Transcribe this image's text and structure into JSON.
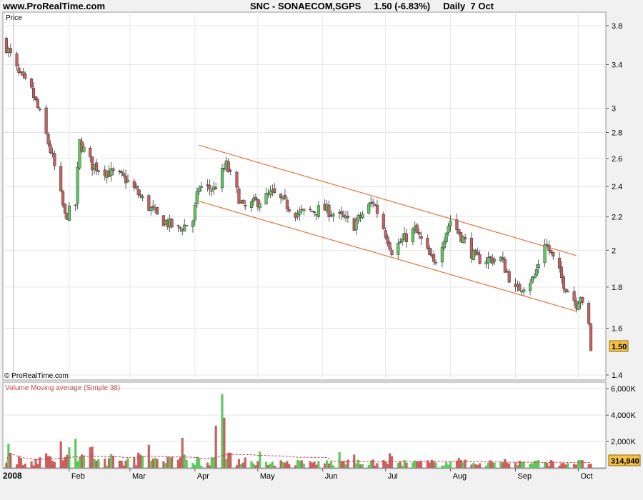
{
  "header": {
    "site": "www.ProRealTime.com",
    "symbol": "SNC - SONAECOM,SGPS",
    "quote": "1.50 (-6.83%)",
    "period": "Daily",
    "date": "7 Oct"
  },
  "price_panel": {
    "axis_label": "Price",
    "copyright": "© ProRealTime.com",
    "last_price_badge": "1.50",
    "y_ticks": [
      "3.8",
      "3.4",
      "3",
      "2.8",
      "2.6",
      "2.4",
      "2.2",
      "2",
      "1.8",
      "1.6",
      "1.4"
    ]
  },
  "volume_panel": {
    "label": "Volume Moving average (Simple 38)",
    "y_ticks": [
      "6,000K",
      "4,000K",
      "2,000K"
    ],
    "last_volume_badge": "314,940"
  },
  "x_axis": {
    "year_label": "2008",
    "months": [
      "Feb",
      "Mar",
      "Apr",
      "May",
      "Jun",
      "Jul",
      "Aug",
      "Sep",
      "Oct"
    ]
  },
  "colors": {
    "up": "#5dc85d",
    "down": "#c86060",
    "channel": "#e8733a",
    "volume_ma": "#d04040",
    "badge_price": "#f5c242"
  },
  "chart_data": {
    "type": "candlestick",
    "title": "SNC - SONAECOM,SGPS",
    "period": "Daily",
    "y_scale": "log",
    "ylim": [
      1.38,
      3.95
    ],
    "last_close": 1.5,
    "change_pct": -6.83,
    "close_anchors": [
      {
        "date": "2008-01-02",
        "close": 3.58
      },
      {
        "date": "2008-01-08",
        "close": 3.3
      },
      {
        "date": "2008-01-14",
        "close": 3.15
      },
      {
        "date": "2008-01-18",
        "close": 2.95
      },
      {
        "date": "2008-01-24",
        "close": 2.6
      },
      {
        "date": "2008-01-30",
        "close": 2.2
      },
      {
        "date": "2008-02-04",
        "close": 2.28
      },
      {
        "date": "2008-02-06",
        "close": 2.72
      },
      {
        "date": "2008-02-12",
        "close": 2.55
      },
      {
        "date": "2008-02-20",
        "close": 2.5
      },
      {
        "date": "2008-02-28",
        "close": 2.45
      },
      {
        "date": "2008-03-06",
        "close": 2.33
      },
      {
        "date": "2008-03-14",
        "close": 2.2
      },
      {
        "date": "2008-03-24",
        "close": 2.12
      },
      {
        "date": "2008-03-31",
        "close": 2.18
      },
      {
        "date": "2008-04-03",
        "close": 2.4
      },
      {
        "date": "2008-04-10",
        "close": 2.38
      },
      {
        "date": "2008-04-16",
        "close": 2.55
      },
      {
        "date": "2008-04-24",
        "close": 2.25
      },
      {
        "date": "2008-05-08",
        "close": 2.35
      },
      {
        "date": "2008-05-20",
        "close": 2.22
      },
      {
        "date": "2008-06-02",
        "close": 2.25
      },
      {
        "date": "2008-06-16",
        "close": 2.15
      },
      {
        "date": "2008-06-25",
        "close": 2.3
      },
      {
        "date": "2008-07-04",
        "close": 2.0
      },
      {
        "date": "2008-07-15",
        "close": 2.12
      },
      {
        "date": "2008-07-24",
        "close": 1.92
      },
      {
        "date": "2008-08-01",
        "close": 2.18
      },
      {
        "date": "2008-08-13",
        "close": 1.95
      },
      {
        "date": "2008-08-25",
        "close": 1.95
      },
      {
        "date": "2008-09-01",
        "close": 1.78
      },
      {
        "date": "2008-09-10",
        "close": 1.85
      },
      {
        "date": "2008-09-15",
        "close": 2.05
      },
      {
        "date": "2008-09-24",
        "close": 1.82
      },
      {
        "date": "2008-09-30",
        "close": 1.72
      },
      {
        "date": "2008-10-02",
        "close": 1.76
      },
      {
        "date": "2008-10-03",
        "close": 1.7
      },
      {
        "date": "2008-10-06",
        "close": 1.61
      },
      {
        "date": "2008-10-07",
        "close": 1.5
      }
    ],
    "channel_lines": [
      {
        "from": {
          "date": "2008-04-03",
          "price": 2.7
        },
        "to": {
          "date": "2008-09-30",
          "price": 1.97
        }
      },
      {
        "from": {
          "date": "2008-04-03",
          "price": 2.3
        },
        "to": {
          "date": "2008-09-30",
          "price": 1.68
        }
      }
    ],
    "volume": {
      "unit": "shares",
      "ylim": [
        0,
        6500000
      ],
      "ma_period": 38,
      "last_volume": 314940,
      "peaks": [
        {
          "date": "2008-04-14",
          "volume": 5600000
        },
        {
          "date": "2008-04-11",
          "volume": 3200000
        },
        {
          "date": "2008-04-15",
          "volume": 3800000
        },
        {
          "date": "2008-02-04",
          "volume": 2200000
        },
        {
          "date": "2008-01-28",
          "volume": 2000000
        }
      ]
    }
  }
}
